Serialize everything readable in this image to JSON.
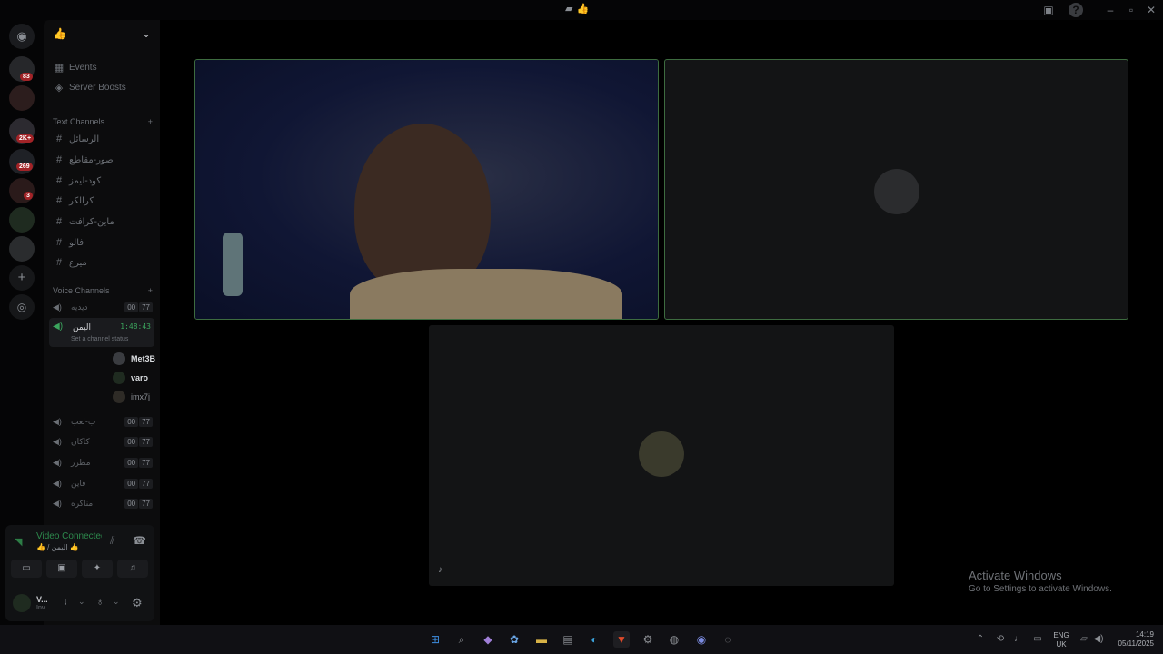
{
  "titlebar": {
    "title_emoji": "👍"
  },
  "server": {
    "name_emoji": "👍"
  },
  "menu": {
    "events": "Events",
    "boosts": "Server Boosts"
  },
  "rail_badges": {
    "b1": "83",
    "b2": "2K+",
    "b3": "269",
    "b4": "3"
  },
  "text_channels": {
    "header": "Text Channels",
    "items": [
      "الرسائل",
      "صور-مقاطع",
      "كود-ليمز",
      "كرالكر",
      "ماين-كرافت",
      "فالو",
      "ميرع"
    ]
  },
  "voice_channels": {
    "header": "Voice Channels",
    "items": [
      {
        "name": "ديديه",
        "n1": "00",
        "n2": "77"
      },
      {
        "name": "اليمن",
        "timer": "1:48:43",
        "status": "Set a channel status"
      },
      {
        "name": "ب-لعب",
        "n1": "00",
        "n2": "77"
      },
      {
        "name": "كاكان",
        "n1": "00",
        "n2": "77"
      },
      {
        "name": "مطرر",
        "n1": "00",
        "n2": "77"
      },
      {
        "name": "فاين",
        "n1": "00",
        "n2": "77"
      },
      {
        "name": "مناكره",
        "n1": "00",
        "n2": "77"
      }
    ],
    "members": [
      {
        "name": "Met3B"
      },
      {
        "name": "varo"
      },
      {
        "name": "imx7j"
      }
    ]
  },
  "voice_panel": {
    "status": "Video Connected",
    "sub": "👍 / اليمن 👍",
    "user_short": "V...",
    "user_sub": "Inv..."
  },
  "watermark": {
    "line1": "Activate Windows",
    "line2": "Go to Settings to activate Windows."
  },
  "tray": {
    "lang1": "ENG",
    "lang2": "UK",
    "time": "14:19",
    "date": "05/11/2025"
  }
}
